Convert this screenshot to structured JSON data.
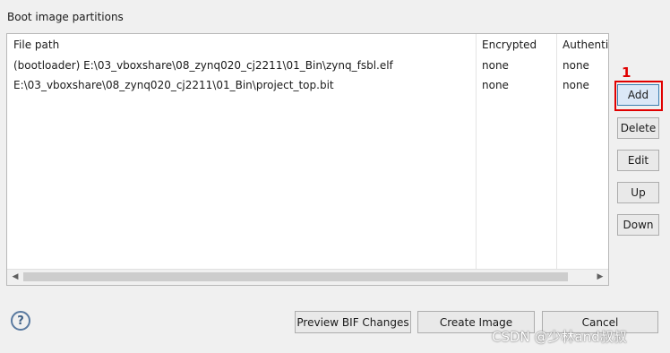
{
  "group_label": "Boot image partitions",
  "table": {
    "columns": [
      "File path",
      "Encrypted",
      "Authentic"
    ],
    "rows": [
      [
        "(bootloader) E:\\03_vboxshare\\08_zynq020_cj2211\\01_Bin\\zynq_fsbl.elf",
        "none",
        "none"
      ],
      [
        "E:\\03_vboxshare\\08_zynq020_cj2211\\01_Bin\\project_top.bit",
        "none",
        "none"
      ]
    ]
  },
  "side_buttons": {
    "add": "Add",
    "delete": "Delete",
    "edit": "Edit",
    "up": "Up",
    "down": "Down"
  },
  "annotation_marker": "1",
  "footer": {
    "help_icon": "?",
    "preview_label": "Preview BIF Changes",
    "create_label": "Create Image",
    "cancel_label": "Cancel"
  },
  "watermark": "CSDN @少林and叔叔",
  "colors": {
    "highlight": "#e00000",
    "add_button_bg": "#dbe8f7"
  }
}
